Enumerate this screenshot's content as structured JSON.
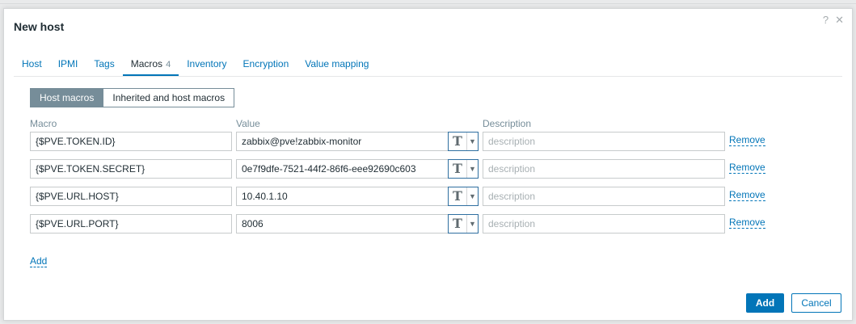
{
  "dialog": {
    "title": "New host",
    "help_label": "?",
    "close_label": "✕"
  },
  "tabs": [
    {
      "label": "Host"
    },
    {
      "label": "IPMI"
    },
    {
      "label": "Tags"
    },
    {
      "label": "Macros",
      "count": "4"
    },
    {
      "label": "Inventory"
    },
    {
      "label": "Encryption"
    },
    {
      "label": "Value mapping"
    }
  ],
  "macro_view": {
    "host_macros": "Host macros",
    "inherited_macros": "Inherited and host macros"
  },
  "columns": {
    "macro": "Macro",
    "value": "Value",
    "description": "Description"
  },
  "macros": [
    {
      "macro": "{$PVE.TOKEN.ID}",
      "value": "zabbix@pve!zabbix-monitor",
      "type_icon": "T",
      "description_placeholder": "description",
      "remove_label": "Remove"
    },
    {
      "macro": "{$PVE.TOKEN.SECRET}",
      "value": "0e7f9dfe-7521-44f2-86f6-eee92690c603",
      "type_icon": "T",
      "description_placeholder": "description",
      "remove_label": "Remove"
    },
    {
      "macro": "{$PVE.URL.HOST}",
      "value": "10.40.1.10",
      "type_icon": "T",
      "description_placeholder": "description",
      "remove_label": "Remove"
    },
    {
      "macro": "{$PVE.URL.PORT}",
      "value": "8006",
      "type_icon": "T",
      "description_placeholder": "description",
      "remove_label": "Remove"
    }
  ],
  "add_macro_label": "Add",
  "footer": {
    "add_label": "Add",
    "cancel_label": "Cancel"
  },
  "colors": {
    "accent": "#0275b8",
    "segment_active": "#768d99"
  }
}
